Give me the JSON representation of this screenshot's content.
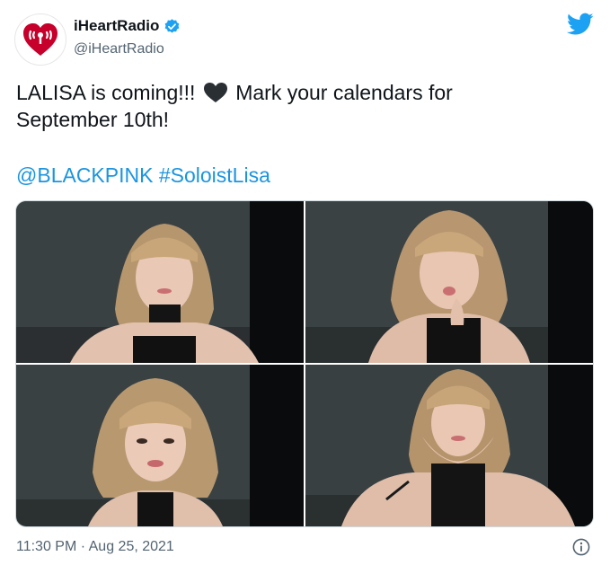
{
  "author": {
    "display_name": "iHeartRadio",
    "handle": "@iHeartRadio",
    "verified": true,
    "avatar_icon": "iheartradio-logo-icon",
    "brand_color": "#c6002b"
  },
  "tweet": {
    "line1_before_heart": "LALISA is coming!!!",
    "heart_icon": "black-heart-icon",
    "line1_after_heart": "Mark your calendars for",
    "line2": "September 10th!",
    "mention": "@BLACKPINK",
    "hashtag": "#SoloistLisa",
    "link_color": "#1b95e0"
  },
  "media": {
    "photos": [
      {
        "icon": "photo-icon"
      },
      {
        "icon": "photo-icon"
      },
      {
        "icon": "photo-icon"
      },
      {
        "icon": "photo-icon"
      }
    ]
  },
  "footer": {
    "timestamp": "11:30 PM · Aug 25, 2021",
    "info_icon": "info-icon"
  },
  "brand": {
    "platform_icon": "twitter-bird-icon",
    "platform_color": "#1da1f2"
  }
}
